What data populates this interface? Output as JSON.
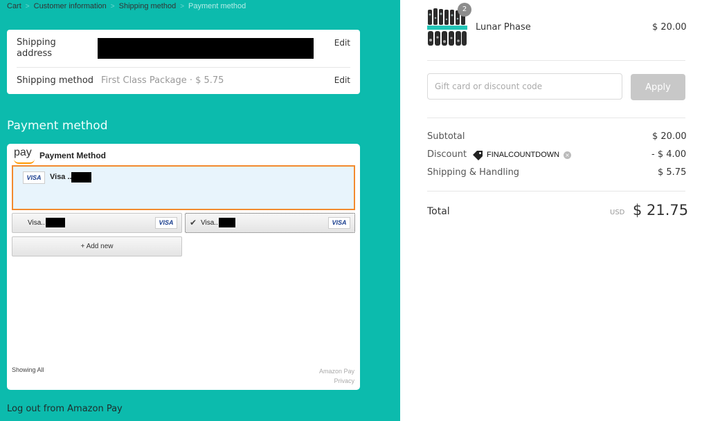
{
  "breadcrumb": {
    "items": [
      "Cart",
      "Customer information",
      "Shipping method",
      "Payment method"
    ],
    "separator": ">"
  },
  "shipping": {
    "address_label": "Shipping address",
    "address_edit": "Edit",
    "method_label": "Shipping method",
    "method_value": "First Class Package · $ 5.75",
    "method_edit": "Edit"
  },
  "payment": {
    "section_title": "Payment Method",
    "heading": "Payment method",
    "pay_logo": "pay",
    "selected_card": {
      "brand_badge": "VISA",
      "label": "Visa .."
    },
    "cards": [
      {
        "label": "Visa..",
        "brand_badge": "VISA",
        "checked": false
      },
      {
        "label": "Visa..",
        "brand_badge": "VISA",
        "checked": true,
        "check_mark": "✔"
      }
    ],
    "add_new": "+ Add new",
    "showing": "Showing All",
    "footer_brand": "Amazon Pay",
    "footer_privacy": "Privacy",
    "logout": "Log out from Amazon Pay"
  },
  "order": {
    "product_name": "Lunar Phase",
    "product_price": "$ 20.00",
    "quantity_badge": "2",
    "gift_placeholder": "Gift card or discount code",
    "apply_label": "Apply",
    "subtotal_label": "Subtotal",
    "subtotal_value": "$ 20.00",
    "discount_label": "Discount",
    "discount_code": "FINALCOUNTDOWN",
    "discount_value": "- $ 4.00",
    "shipping_label": "Shipping & Handling",
    "shipping_value": "$ 5.75",
    "total_label": "Total",
    "total_currency": "USD",
    "total_value": "$ 21.75"
  },
  "colors": {
    "panel_bg": "#0cbbad",
    "selected_border": "#f28a2e",
    "selected_bg": "#e8f4fc",
    "apply_bg": "#c8c8c8"
  }
}
